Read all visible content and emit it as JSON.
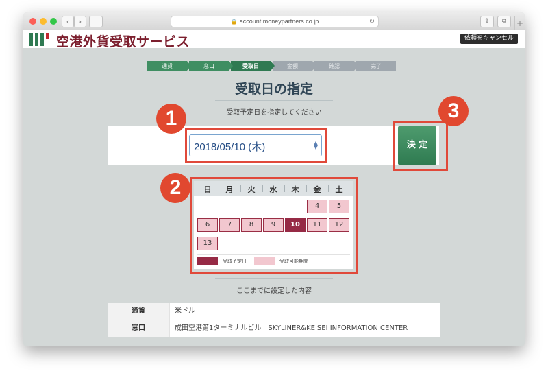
{
  "browser": {
    "url": "account.moneypartners.co.jp",
    "back_icon": "chevron-left",
    "forward_icon": "chevron-right"
  },
  "header": {
    "title": "空港外貨受取サービス",
    "cancel_label": "依頼をキャンセル",
    "logo_colors": [
      "#2f7a52",
      "#2f7a52",
      "#2f7a52",
      "#c0282f"
    ]
  },
  "steps": [
    {
      "label": "通貨",
      "state": "done"
    },
    {
      "label": "窓口",
      "state": "done"
    },
    {
      "label": "受取日",
      "state": "current"
    },
    {
      "label": "金額",
      "state": "todo"
    },
    {
      "label": "確認",
      "state": "todo"
    },
    {
      "label": "完了",
      "state": "todo"
    }
  ],
  "page": {
    "title": "受取日の指定",
    "subtitle": "受取予定日を指定してください"
  },
  "date_select": {
    "value": "2018/05/10 (木)"
  },
  "decide_label": "決 定",
  "badges": [
    "1",
    "2",
    "3"
  ],
  "calendar": {
    "weekdays": [
      "日",
      "月",
      "火",
      "水",
      "木",
      "金",
      "土"
    ],
    "weeks": [
      [
        null,
        null,
        null,
        null,
        null,
        {
          "d": "4",
          "s": "avail"
        },
        {
          "d": "5",
          "s": "avail"
        }
      ],
      [
        {
          "d": "6",
          "s": "avail"
        },
        {
          "d": "7",
          "s": "avail"
        },
        {
          "d": "8",
          "s": "avail"
        },
        {
          "d": "9",
          "s": "avail"
        },
        {
          "d": "10",
          "s": "sel"
        },
        {
          "d": "11",
          "s": "avail"
        },
        {
          "d": "12",
          "s": "avail"
        }
      ],
      [
        {
          "d": "13",
          "s": "avail"
        },
        null,
        null,
        null,
        null,
        null,
        null
      ]
    ],
    "legend_selected": "受取予定日",
    "legend_available": "受取可能期間",
    "color_selected": "#962a45",
    "color_available": "#f2c7cf"
  },
  "summary": {
    "label": "ここまでに設定した内容",
    "rows": [
      {
        "key": "通貨",
        "value": "米ドル"
      },
      {
        "key": "窓口",
        "value": "成田空港第1ターミナルビル　SKYLINER&KEISEI INFORMATION CENTER"
      }
    ]
  }
}
